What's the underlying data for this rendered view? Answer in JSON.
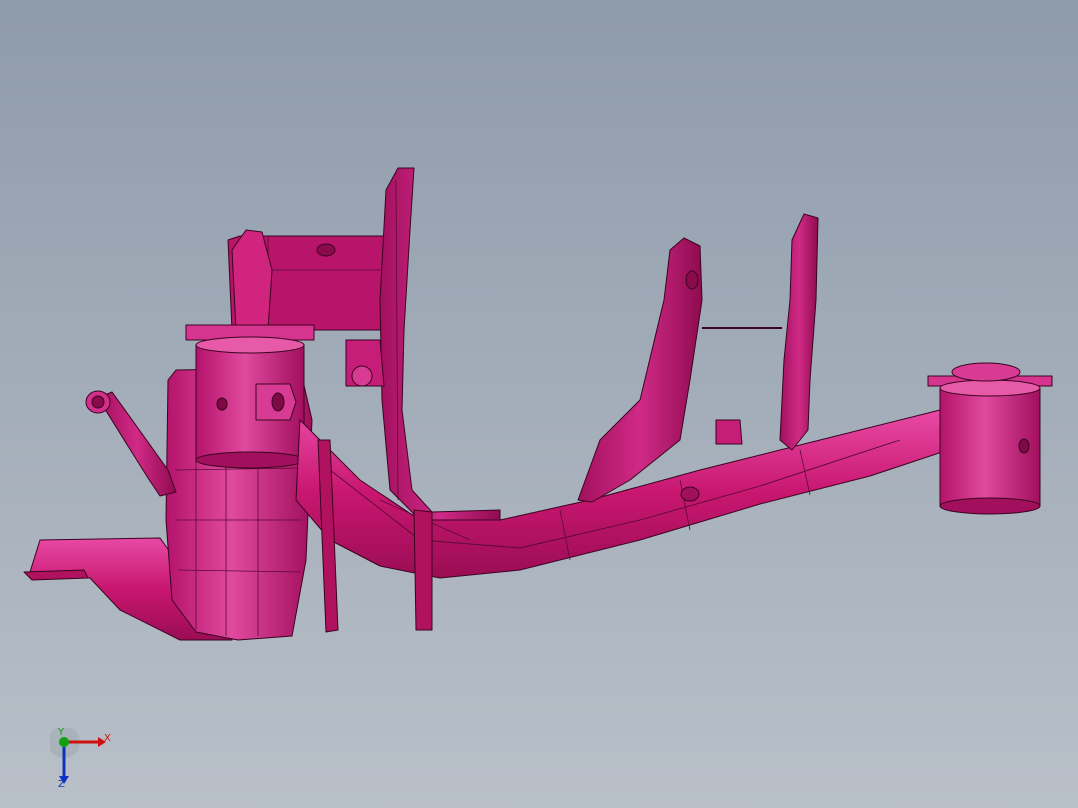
{
  "viewport": {
    "background_top": "#8e9bab",
    "background_bottom": "#b9c0c8"
  },
  "model": {
    "part_color": "#c8166f",
    "highlight_color": "#ea4fa7",
    "edge_color": "#3a0420"
  },
  "triad": {
    "x_label": "X",
    "y_label": "Y",
    "z_label": "Z",
    "x_color": "#d01010",
    "y_color": "#10a010",
    "z_color": "#1030c0"
  }
}
